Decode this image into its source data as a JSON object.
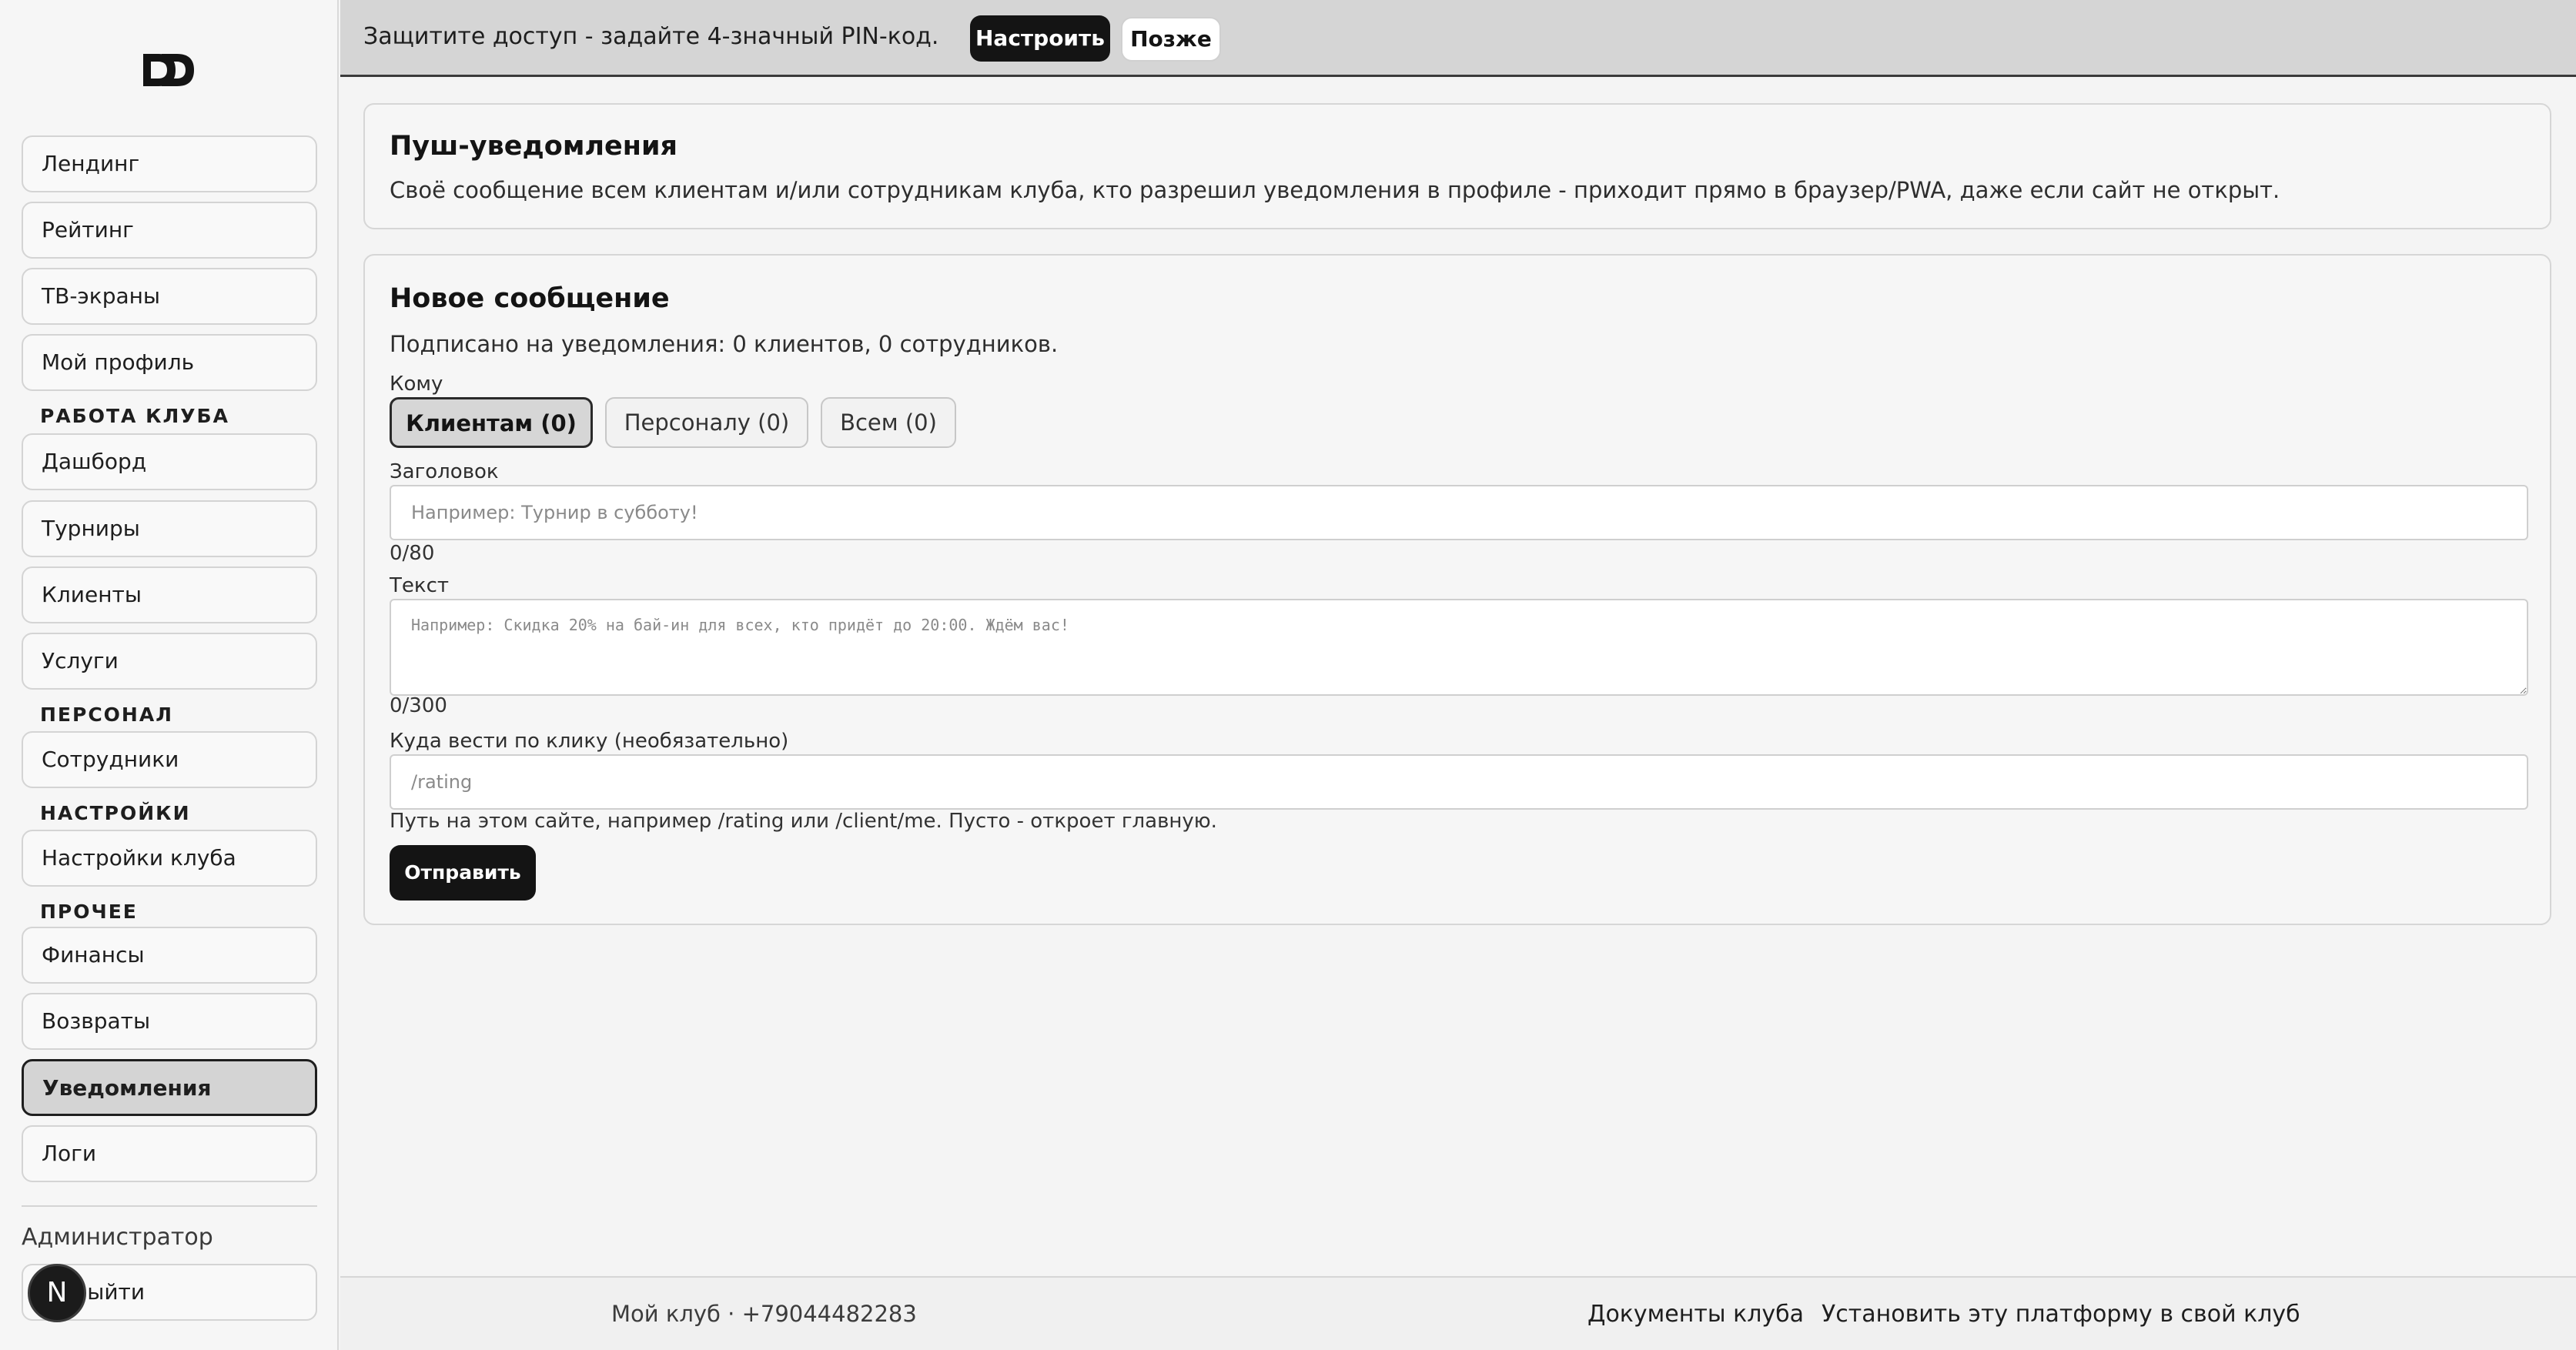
{
  "banner": {
    "text": "Защитите доступ - задайте 4-значный PIN-код.",
    "setup_label": "Настроить",
    "later_label": "Позже"
  },
  "sidebar": {
    "items_top": [
      {
        "label": "Лендинг"
      },
      {
        "label": "Рейтинг"
      },
      {
        "label": "ТВ-экраны"
      },
      {
        "label": "Мой профиль"
      }
    ],
    "sections": {
      "club_work": "РАБОТА КЛУБА",
      "staff": "ПЕРСОНАЛ",
      "settings": "НАСТРОЙКИ",
      "other": "ПРОЧЕЕ"
    },
    "club_work_items": [
      {
        "label": "Дашборд"
      },
      {
        "label": "Турниры"
      },
      {
        "label": "Клиенты"
      },
      {
        "label": "Услуги"
      }
    ],
    "staff_items": [
      {
        "label": "Сотрудники"
      }
    ],
    "settings_items": [
      {
        "label": "Настройки клуба"
      }
    ],
    "other_items": [
      {
        "label": "Финансы"
      },
      {
        "label": "Возвраты"
      },
      {
        "label": "Уведомления"
      },
      {
        "label": "Логи"
      }
    ],
    "admin_label": "Администратор",
    "logout_label": "Выйти",
    "avatar_letter": "N"
  },
  "push_card": {
    "title": "Пуш-уведомления",
    "description": "Своё сообщение всем клиентам и/или сотрудникам клуба, кто разрешил уведомления в профиле - приходит прямо в браузер/PWA, даже если сайт не открыт."
  },
  "message_card": {
    "title": "Новое сообщение",
    "subscribed": "Подписано на уведомления: 0 клиентов, 0 сотрудников.",
    "to_label": "Кому",
    "recipients": [
      {
        "label": "Клиентам (0)",
        "active": true
      },
      {
        "label": "Персоналу (0)",
        "active": false
      },
      {
        "label": "Всем (0)",
        "active": false
      }
    ],
    "heading_label": "Заголовок",
    "heading_placeholder": "Например: Турнир в субботу!",
    "heading_counter": "0/80",
    "text_label": "Текст",
    "text_placeholder": "Например: Скидка 20% на бай-ин для всех, кто придёт до 20:00. Ждём вас!",
    "text_counter": "0/300",
    "link_label": "Куда вести по клику (необязательно)",
    "link_placeholder": "/rating",
    "link_hint": "Путь на этом сайте, например /rating или /client/me. Пусто - откроет главную.",
    "send_label": "Отправить"
  },
  "footer": {
    "club_info": "Мой клуб · +79044482283",
    "docs_link": "Документы клуба",
    "install_link": "Установить эту платформу в свой клуб"
  }
}
